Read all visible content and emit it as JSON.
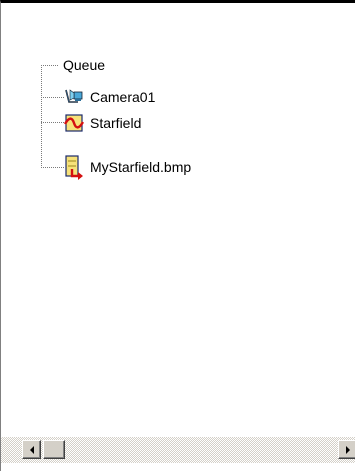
{
  "tree": {
    "root": {
      "label": "Queue"
    },
    "children": [
      {
        "label": "Camera01",
        "icon": "camera-icon"
      },
      {
        "label": "Starfield",
        "icon": "starfield-icon"
      },
      {
        "label": "MyStarfield.bmp",
        "icon": "bitmap-output-icon"
      }
    ]
  },
  "scrollbar": {
    "left_arrow_icon": "arrow-left-icon",
    "right_arrow_icon": "arrow-right-icon"
  },
  "colors": {
    "background": "#ffffff",
    "chrome": "#d4d0c8",
    "icon_yellow": "#f7e27a",
    "icon_red": "#d41010",
    "icon_navy": "#1a2a6c"
  }
}
